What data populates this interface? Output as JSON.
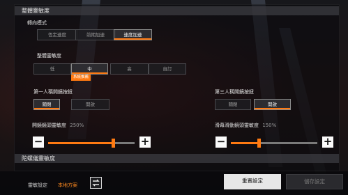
{
  "sections": {
    "sensitivity_header": "整體靈敏度",
    "gyro_header": "陀螺儀靈敏度"
  },
  "turn_mode": {
    "label": "轉向模式",
    "options": [
      "恆定速度",
      "前期加速",
      "速度加速"
    ],
    "selected": "速度加速"
  },
  "overall_sensitivity": {
    "label": "整體靈敏度",
    "options": [
      "低",
      "中",
      "高",
      "自訂"
    ],
    "selected": "中",
    "tag": "系統推薦"
  },
  "first_person_button": {
    "label": "第一人稱開鏡按鈕",
    "options": [
      "關閉",
      "開啟"
    ],
    "selected": "關閉"
  },
  "third_person_button": {
    "label": "第三人稱開鏡按鈕",
    "options": [
      "關閉",
      "開啟"
    ],
    "selected": "開啟"
  },
  "scope_sensitivity": {
    "label": "開鏡鏡頭靈敏度",
    "value_text": "250%",
    "fraction": 0.75
  },
  "screen_drag_sensitivity": {
    "label": "滑幕滑動鏡頭靈敏度",
    "value_text": "150%",
    "fraction": 0.32
  },
  "footer": {
    "scheme_label": "靈敏設定",
    "scheme_value": "本地方案",
    "reset_button": "重置設定",
    "save_button": "儲存設定"
  },
  "colors": {
    "accent": "#ff7a12"
  },
  "icons": {
    "minus": "−",
    "plus": "+",
    "swap": "swap-icon"
  }
}
